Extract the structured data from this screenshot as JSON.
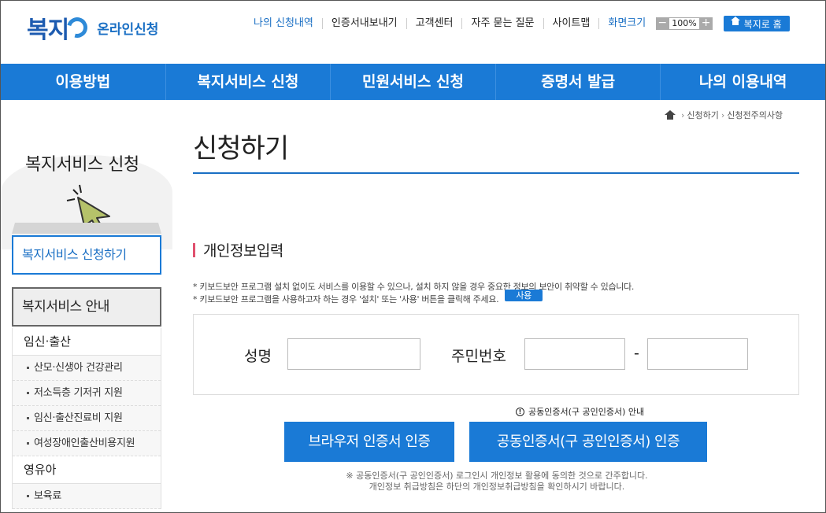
{
  "header": {
    "logo_text": "복지",
    "logo_sub": "온라인신청",
    "util_links": [
      "나의 신청내역",
      "인증서내보내기",
      "고객센터",
      "자주 묻는 질문",
      "사이트맵"
    ],
    "zoom_label": "화면크기",
    "zoom_minus": "−",
    "zoom_value": "100%",
    "zoom_plus": "+",
    "home_label": "복지로 홈"
  },
  "gnb": [
    "이용방법",
    "복지서비스 신청",
    "민원서비스 신청",
    "증명서 발급",
    "나의 이용내역"
  ],
  "breadcrumb": [
    "신청하기",
    "신청전주의사항"
  ],
  "breadcrumb_sep": "›",
  "sidebar": {
    "title": "복지서비스 신청",
    "active_item": "복지서비스 신청하기",
    "section": "복지서비스 안내",
    "groups": [
      {
        "label": "임신·출산",
        "items": [
          "산모·신생아 건강관리",
          "저소득층 기저귀 지원",
          "임신·출산진료비 지원",
          "여성장애인출산비용지원"
        ]
      },
      {
        "label": "영유아",
        "items": [
          "보육료"
        ]
      }
    ]
  },
  "main": {
    "title": "신청하기",
    "section_title": "개인정보입력",
    "notice1": "* 키보드보안 프로그램 설치 없이도 서비스를 이용할 수 있으나, 설치 하지 않을 경우 중요한 정보의 보안이 취약할 수 있습니다.",
    "notice2": "* 키보드보안 프로그램을 사용하고자 하는 경우 '설치' 또는 '사용' 버튼을 클릭해 주세요.",
    "use_button": "사용",
    "name_label": "성명",
    "rrn_label": "주민번호",
    "rrn_dash": "-",
    "cert_info_icon": "!",
    "cert_info": "공동인증서(구 공인인증서) 안내",
    "browser_cert_button": "브라우저 인증서 인증",
    "joint_cert_button": "공동인증서(구 공인인증서) 인증",
    "footnote1": "※ 공동인증서(구 공인인증서) 로그인시 개인정보 활용에 동의한 것으로 간주합니다.",
    "footnote2": "개인정보 취급방침은 하단의 개인정보취급방침을 확인하시기 바랍니다."
  },
  "colors": {
    "primary": "#1a7ad6",
    "accent_bar": "#e0506e"
  }
}
